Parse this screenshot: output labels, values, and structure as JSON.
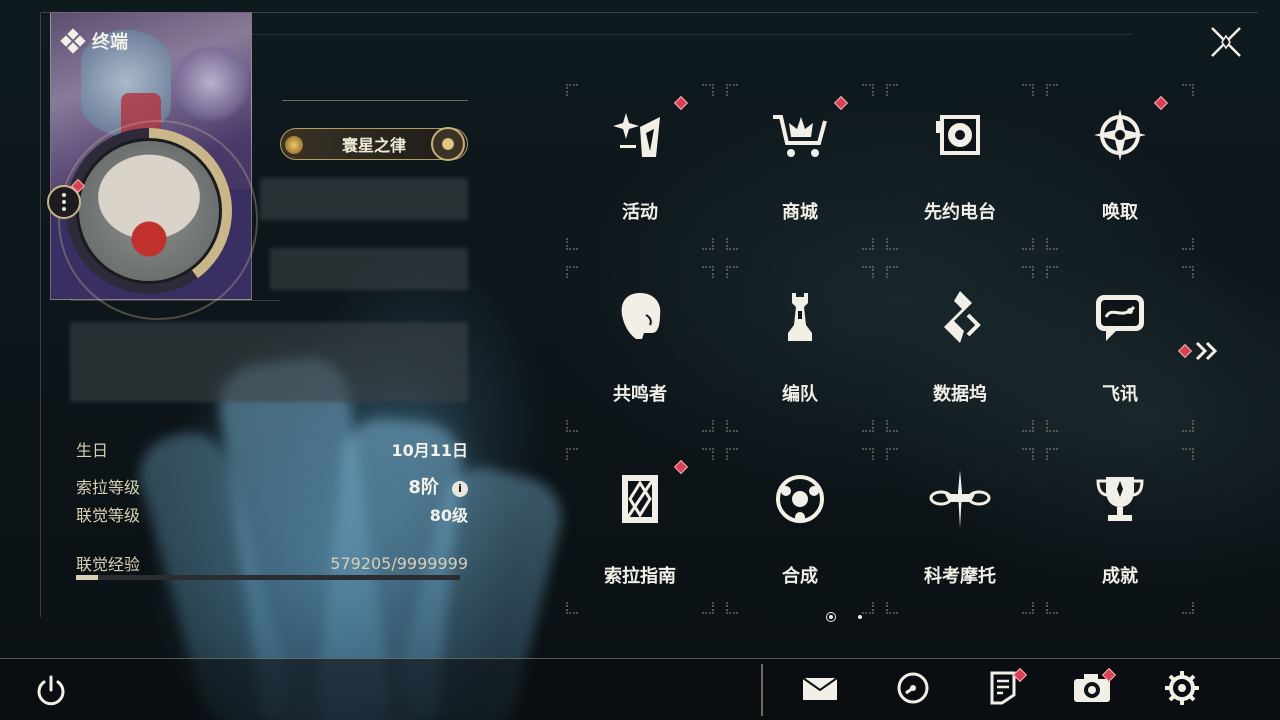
{
  "header": {
    "title": "终端"
  },
  "profile": {
    "title_badge": "寰星之律",
    "fields": [
      {
        "label": "生日",
        "value": "10月11日"
      },
      {
        "label": "索拉等级",
        "value": "8阶"
      },
      {
        "label": "联觉等级",
        "value": "80级"
      }
    ],
    "exp": {
      "label": "联觉经验",
      "value": "579205/9999999",
      "progress": 0.058
    },
    "info_icon": "i"
  },
  "menu": {
    "items": [
      {
        "label": "活动",
        "icon": "sparkle-icon",
        "badge": true
      },
      {
        "label": "商城",
        "icon": "shopping-cart-icon",
        "badge": true
      },
      {
        "label": "先约电台",
        "icon": "radio-icon",
        "badge": false
      },
      {
        "label": "唤取",
        "icon": "compass-star-icon",
        "badge": true
      },
      {
        "label": "共鸣者",
        "icon": "character-icon",
        "badge": false
      },
      {
        "label": "编队",
        "icon": "chess-piece-icon",
        "badge": false
      },
      {
        "label": "数据坞",
        "icon": "data-dock-icon",
        "badge": false
      },
      {
        "label": "飞讯",
        "icon": "chat-icon",
        "badge": false
      },
      {
        "label": "索拉指南",
        "icon": "guide-book-icon",
        "badge": true
      },
      {
        "label": "合成",
        "icon": "synthesis-icon",
        "badge": false
      },
      {
        "label": "科考摩托",
        "icon": "motorcycle-icon",
        "badge": false
      },
      {
        "label": "成就",
        "icon": "trophy-icon",
        "badge": false
      }
    ],
    "page_indicator": {
      "pages": 2,
      "current": 1
    }
  },
  "toolbar": {
    "items": [
      {
        "name": "mail",
        "icon": "mail-icon",
        "badge": false
      },
      {
        "name": "clock",
        "icon": "clock-icon",
        "badge": false
      },
      {
        "name": "notice",
        "icon": "notice-icon",
        "badge": true
      },
      {
        "name": "camera",
        "icon": "camera-icon",
        "badge": true
      },
      {
        "name": "settings",
        "icon": "gear-icon",
        "badge": false
      }
    ]
  },
  "colors": {
    "accent": "#c9b78a",
    "badge": "#d94155",
    "text": "#f2efe7"
  }
}
